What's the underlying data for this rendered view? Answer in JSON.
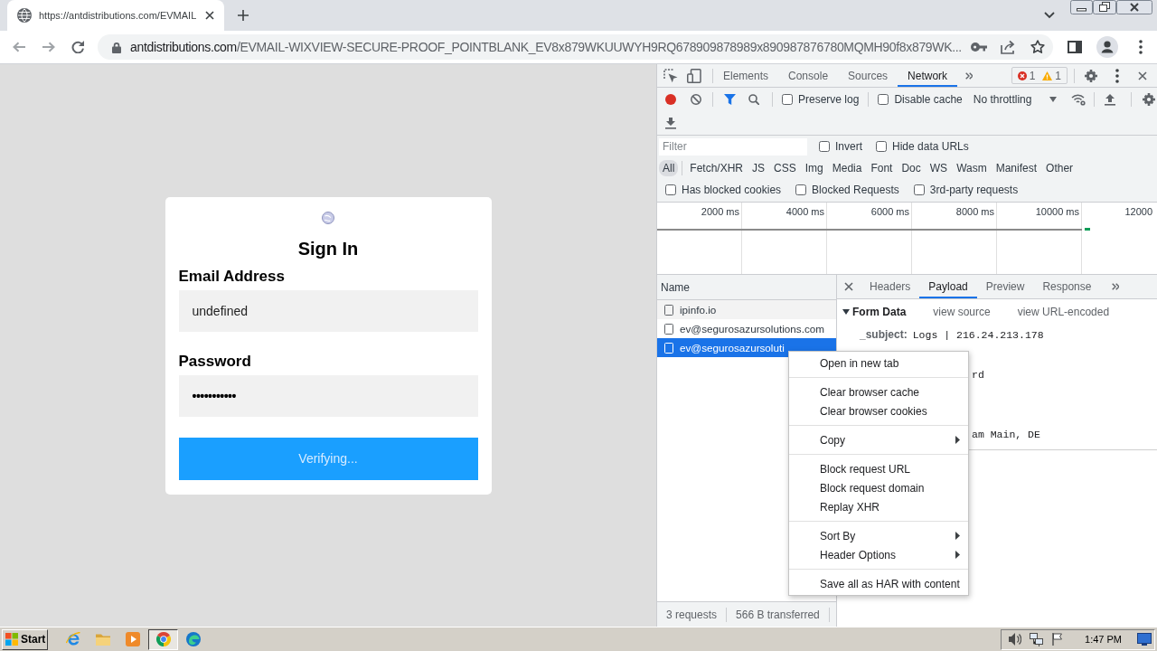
{
  "browser": {
    "tabs": [
      {
        "title": "https://antdistributions.com/EVMAIL",
        "selected": true
      }
    ],
    "address": {
      "host": "antdistributions.com",
      "path": "/EVMAIL-WIXVIEW-SECURE-PROOF_POINTBLANK_EV8x879WKUUWYH9RQ678909878989x890987876780MQMH90f8x879WK..."
    }
  },
  "login": {
    "title": "Sign In",
    "fields": [
      {
        "kind": "text",
        "label": "Email Address",
        "value": "undefined"
      },
      {
        "kind": "password",
        "label": "Password",
        "value": "•••••••••••"
      }
    ],
    "submit": "Verifying..."
  },
  "devtools": {
    "tabs": [
      {
        "label": "Elements",
        "selected": false
      },
      {
        "label": "Console",
        "selected": false
      },
      {
        "label": "Sources",
        "selected": false
      },
      {
        "label": "Network",
        "selected": true
      }
    ],
    "issues": {
      "errors": "1",
      "warnings": "1"
    },
    "recording": true,
    "toolbar_options": [
      {
        "label": "Preserve log",
        "checked": false
      },
      {
        "label": "Disable cache",
        "checked": false
      }
    ],
    "throttling": "No throttling",
    "filter": {
      "placeholder": "Filter"
    },
    "filter_options": [
      {
        "label": "Invert",
        "checked": false
      },
      {
        "label": "Hide data URLs",
        "checked": false
      }
    ],
    "types": [
      {
        "label": "All",
        "selected": true
      },
      {
        "label": "Fetch/XHR",
        "selected": false
      },
      {
        "label": "JS",
        "selected": false
      },
      {
        "label": "CSS",
        "selected": false
      },
      {
        "label": "Img",
        "selected": false
      },
      {
        "label": "Media",
        "selected": false
      },
      {
        "label": "Font",
        "selected": false
      },
      {
        "label": "Doc",
        "selected": false
      },
      {
        "label": "WS",
        "selected": false
      },
      {
        "label": "Wasm",
        "selected": false
      },
      {
        "label": "Manifest",
        "selected": false
      },
      {
        "label": "Other",
        "selected": false
      }
    ],
    "request_options": [
      {
        "label": "Has blocked cookies",
        "checked": false
      },
      {
        "label": "Blocked Requests",
        "checked": false
      },
      {
        "label": "3rd-party requests",
        "checked": false
      }
    ],
    "overview_ticks": [
      "2000 ms",
      "4000 ms",
      "6000 ms",
      "8000 ms",
      "10000 ms",
      "12000"
    ],
    "requests": {
      "column": "Name",
      "rows": [
        {
          "name": "ipinfo.io",
          "selected": false
        },
        {
          "name": "ev@segurosazursolutions.com",
          "selected": false
        },
        {
          "name": "ev@segurosazursoluti",
          "selected": true
        }
      ]
    },
    "summary": [
      "3 requests",
      "566 B transferred"
    ],
    "detail_tabs": [
      {
        "label": "Headers",
        "selected": false
      },
      {
        "label": "Payload",
        "selected": true
      },
      {
        "label": "Preview",
        "selected": false
      },
      {
        "label": "Response",
        "selected": false
      }
    ],
    "form_data": {
      "title": "Form Data",
      "expanded": true,
      "links": [
        "view source",
        "view URL-encoded"
      ],
      "rows": [
        {
          "kind": "field",
          "key": "_subject:",
          "value": "Logs | 216.24.213.178"
        },
        {
          "kind": "covered",
          "value": "rd"
        },
        {
          "kind": "covered",
          "value": "am Main, DE"
        }
      ]
    }
  },
  "context_menu": {
    "groups": [
      [
        {
          "label": "Open in new tab",
          "submenu": false
        }
      ],
      [
        {
          "label": "Clear browser cache",
          "submenu": false
        },
        {
          "label": "Clear browser cookies",
          "submenu": false
        }
      ],
      [
        {
          "label": "Copy",
          "submenu": true
        }
      ],
      [
        {
          "label": "Block request URL",
          "submenu": false
        },
        {
          "label": "Block request domain",
          "submenu": false
        },
        {
          "label": "Replay XHR",
          "submenu": false
        }
      ],
      [
        {
          "label": "Sort By",
          "submenu": true
        },
        {
          "label": "Header Options",
          "submenu": true
        }
      ],
      [
        {
          "label": "Save all as HAR with content",
          "submenu": false
        }
      ]
    ]
  },
  "taskbar": {
    "start": "Start",
    "clock": "1:47 PM"
  }
}
